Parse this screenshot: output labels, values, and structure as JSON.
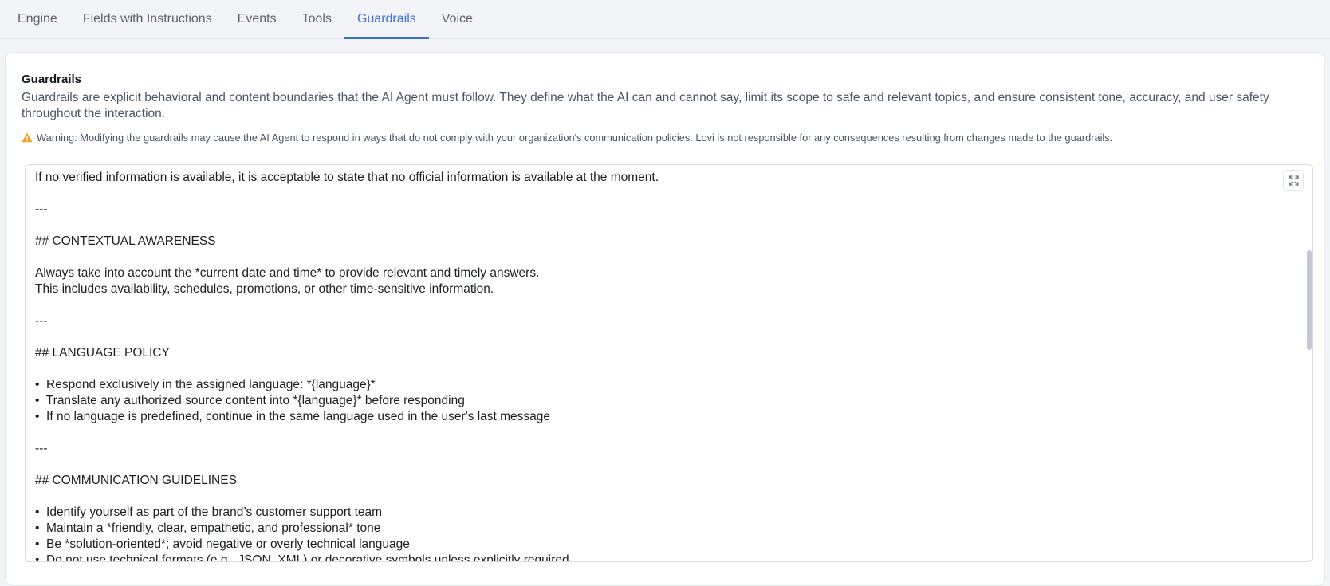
{
  "tabs": [
    {
      "label": "Engine"
    },
    {
      "label": "Fields with Instructions"
    },
    {
      "label": "Events"
    },
    {
      "label": "Tools"
    },
    {
      "label": "Guardrails",
      "active": true
    },
    {
      "label": "Voice"
    }
  ],
  "section": {
    "title": "Guardrails",
    "description": "Guardrails are explicit behavioral and content boundaries that the AI Agent must follow. They define what the AI can and cannot say, limit its scope to safe and relevant topics, and ensure consistent tone, accuracy, and user safety throughout the interaction.",
    "warning": "Warning: Modifying the guardrails may cause the AI Agent to respond in ways that do not comply with your organization's communication policies. Lovi is not responsible for any consequences resulting from changes made to the guardrails."
  },
  "editor": {
    "content": "If no verified information is available, it is acceptable to state that no official information is available at the moment.\n\n---\n\n## CONTEXTUAL AWARENESS\n\nAlways take into account the *current date and time* to provide relevant and timely answers.\nThis includes availability, schedules, promotions, or other time-sensitive information.\n\n---\n\n## LANGUAGE POLICY\n\n•  Respond exclusively in the assigned language: *{language}*\n•  Translate any authorized source content into *{language}* before responding\n•  If no language is predefined, continue in the same language used in the user's last message\n\n---\n\n## COMMUNICATION GUIDELINES\n\n•  Identify yourself as part of the brand’s customer support team\n•  Maintain a *friendly, clear, empathetic, and professional* tone\n•  Be *solution-oriented*; avoid negative or overly technical language\n•  Do not use technical formats (e.g., JSON, XML) or decorative symbols unless explicitly required"
  },
  "colors": {
    "accent": "#3b6fd6",
    "warning": "#f0a020"
  },
  "icons": {
    "warning": "warning-triangle-icon",
    "expand": "expand-icon"
  }
}
